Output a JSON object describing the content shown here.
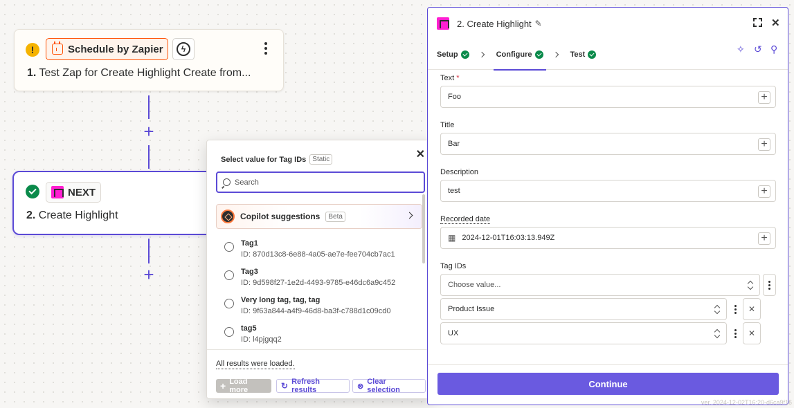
{
  "canvas": {
    "step1": {
      "app_name": "Schedule by Zapier",
      "number": "1.",
      "title": "Test Zap for Create Highlight Create from..."
    },
    "step2": {
      "app_name": "NEXT",
      "number": "2.",
      "title": "Create Highlight"
    }
  },
  "popover": {
    "title": "Select value for Tag IDs",
    "badge": "Static",
    "search_placeholder": "Search",
    "copilot_label": "Copilot suggestions",
    "copilot_badge": "Beta",
    "options": [
      {
        "label": "Tag1",
        "id": "ID: 870d13c8-6e88-4a05-ae7e-fee704cb7ac1"
      },
      {
        "label": "Tag3",
        "id": "ID: 9d598f27-1e2d-4493-9785-e46dc6a9c452"
      },
      {
        "label": "Very long tag, tag, tag",
        "id": "ID: 9f63a844-a4f9-46d8-ba3f-c788d1c09cd0"
      },
      {
        "label": "tag5",
        "id": "ID: l4pjgqq2"
      }
    ],
    "status": "All results were loaded.",
    "load_more": "Load more",
    "refresh": "Refresh results",
    "clear": "Clear selection"
  },
  "panel": {
    "title": "2. Create Highlight",
    "tabs": [
      {
        "label": "Setup"
      },
      {
        "label": "Configure"
      },
      {
        "label": "Test"
      }
    ],
    "fields": {
      "text": {
        "label": "Text",
        "required": "*",
        "value": "Foo"
      },
      "title": {
        "label": "Title",
        "value": "Bar"
      },
      "description": {
        "label": "Description",
        "value": "test"
      },
      "recorded_date": {
        "label": "Recorded date",
        "value": "2024-12-01T16:03:13.949Z"
      },
      "tag_ids": {
        "label": "Tag IDs",
        "placeholder": "Choose value...",
        "values": [
          "Product Issue",
          "UX"
        ]
      }
    },
    "continue_label": "Continue"
  },
  "version": "ver. 2024-12-02T16:20-d6ca9f16",
  "colors": {
    "accent": "#5b4ad6",
    "continue": "#6a5ae0",
    "success": "#0a8a4a",
    "zapier_orange": "#ff4f00",
    "next_pink": "#ff1fd1",
    "warning": "#f5b301"
  }
}
